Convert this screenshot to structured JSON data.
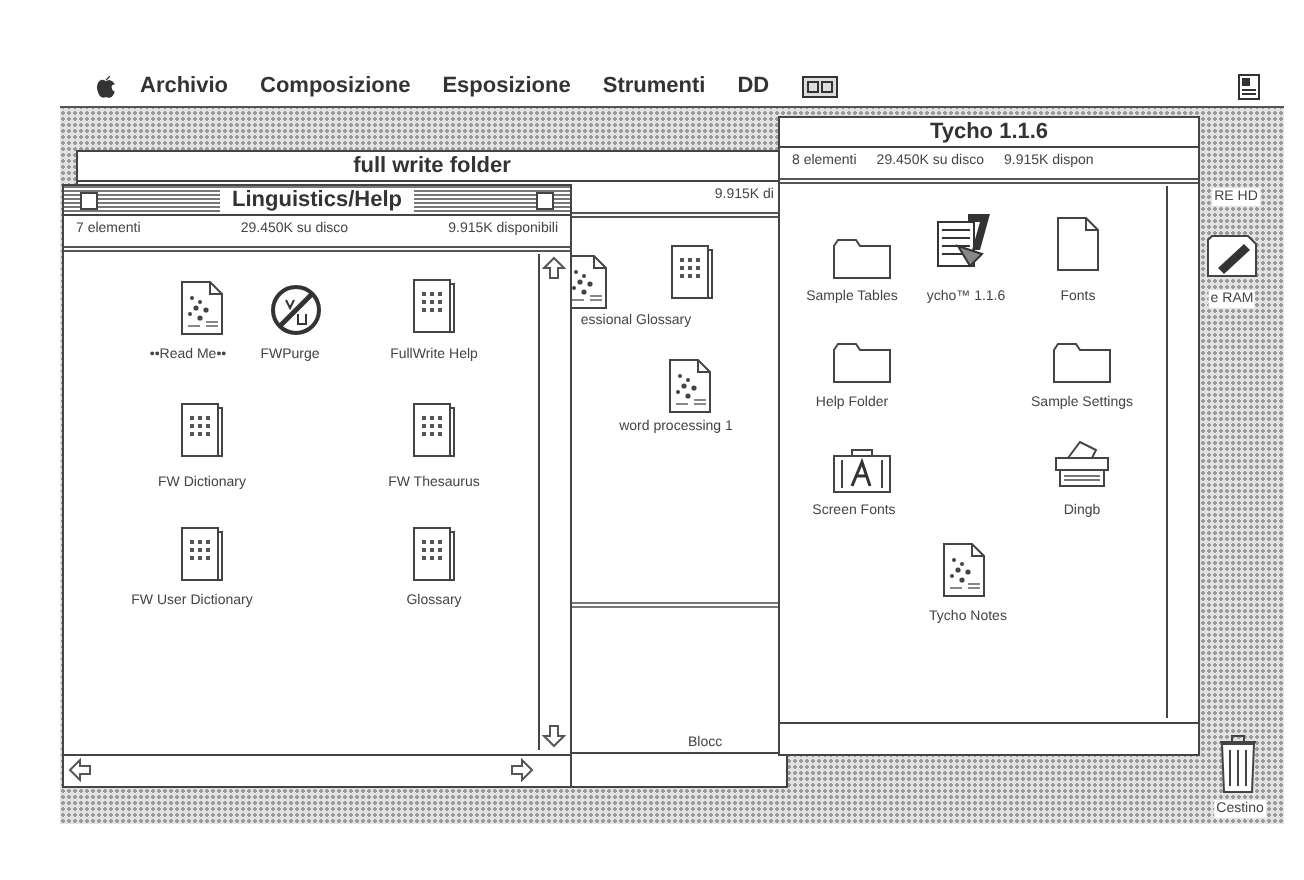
{
  "menu_bar": {
    "items": [
      "Archivio",
      "Composizione",
      "Esposizione",
      "Strumenti",
      "DD"
    ]
  },
  "windows": [
    {
      "title": "full write folder",
      "active": false,
      "info": [
        "9.915K di"
      ],
      "icons": [
        {
          "kind": "document",
          "label": "essional Glossary"
        },
        {
          "kind": "book"
        },
        {
          "kind": "document",
          "label": "word processing 1"
        }
      ],
      "footer": "Blocc"
    },
    {
      "title": "Linguistics/Help",
      "active": true,
      "info": [
        "7 elementi",
        "29.450K su disco",
        "9.915K disponibili"
      ],
      "icons": [
        {
          "kind": "document",
          "label": "••Read Me••"
        },
        {
          "kind": "purge",
          "label": "FWPurge"
        },
        {
          "kind": "book",
          "label": "FullWrite Help"
        },
        {
          "kind": "book",
          "label": "FW Dictionary"
        },
        {
          "kind": "book",
          "label": "FW Thesaurus"
        },
        {
          "kind": "book",
          "label": "FW User Dictionary"
        },
        {
          "kind": "book",
          "label": "Glossary"
        }
      ]
    },
    {
      "title": "Tycho 1.1.6",
      "active": false,
      "info": [
        "8 elementi",
        "29.450K su disco",
        "9.915K dispon"
      ],
      "icons": [
        {
          "kind": "folder",
          "label": "Sample Tables"
        },
        {
          "kind": "application",
          "label": "ycho™ 1.1.6"
        },
        {
          "kind": "blank-document",
          "label": "Fonts"
        },
        {
          "kind": "folder",
          "label": "Help Folder"
        },
        {
          "kind": "folder",
          "label": "Sample Settings"
        },
        {
          "kind": "font-suitcase",
          "label": "Screen Fonts"
        },
        {
          "kind": "printer",
          "label": "Dingb"
        },
        {
          "kind": "document",
          "label": "Tycho Notes"
        }
      ]
    }
  ],
  "desktop_icons": [
    {
      "label": "RE HD"
    },
    {
      "kind": "ram-disk",
      "label": "e RAM"
    },
    {
      "kind": "trash",
      "label": "Cestino"
    }
  ]
}
